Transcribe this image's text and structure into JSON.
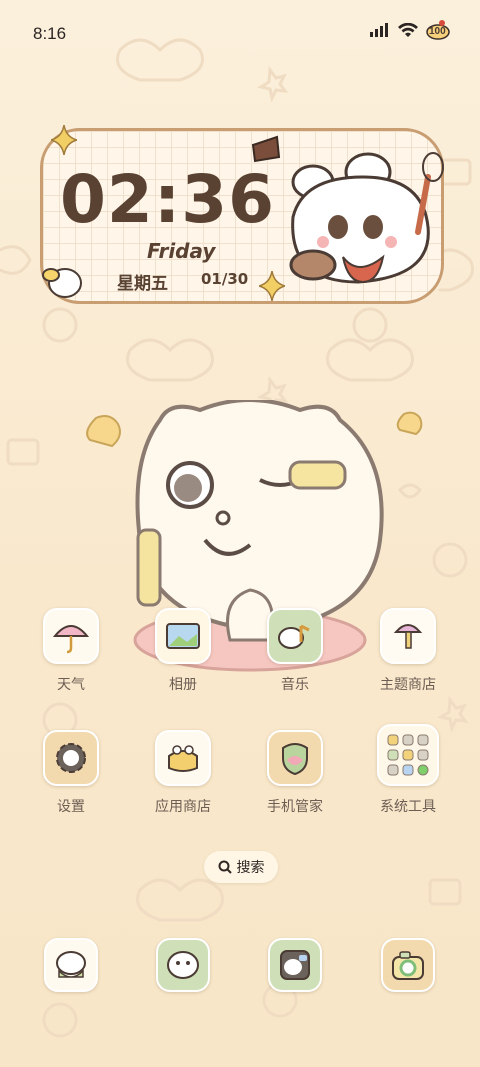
{
  "status_bar": {
    "time": "8:16",
    "battery": "100"
  },
  "widget": {
    "clock": "02:36",
    "day_en": "Friday",
    "day_cn": "星期五",
    "date": "01/30"
  },
  "apps_row1": [
    {
      "label": "天气",
      "icon": "umbrella-icon"
    },
    {
      "label": "相册",
      "icon": "photo-icon"
    },
    {
      "label": "音乐",
      "icon": "music-icon"
    },
    {
      "label": "主题商店",
      "icon": "brush-icon"
    }
  ],
  "apps_row2": [
    {
      "label": "设置",
      "icon": "gear-icon"
    },
    {
      "label": "应用商店",
      "icon": "app-store-icon"
    },
    {
      "label": "手机管家",
      "icon": "shield-icon"
    },
    {
      "label": "系统工具",
      "icon": "tools-folder-icon"
    }
  ],
  "search": {
    "label": "搜索"
  },
  "dock": [
    {
      "icon": "phone-app-icon"
    },
    {
      "icon": "messages-app-icon"
    },
    {
      "icon": "browser-app-icon"
    },
    {
      "icon": "camera-app-icon"
    }
  ],
  "colors": {
    "accent": "#5a4232",
    "label": "#6d5e54",
    "widget_border": "#c89d72"
  }
}
